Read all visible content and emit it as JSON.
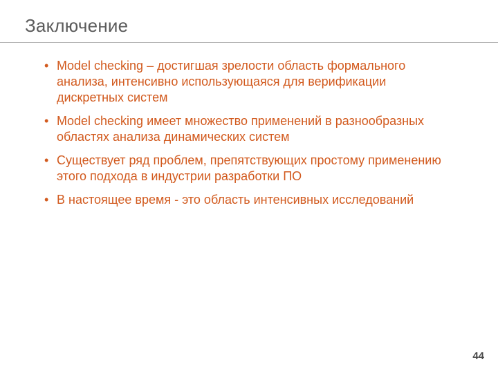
{
  "title": "Заключение",
  "bullets": [
    "Model checking – достигшая зрелости область формального анализа, интенсивно использующаяся для верификации дискретных систем",
    "Model checking имеет множество применений в разнообразных областях анализа динамических систем",
    "Существует ряд проблем, препятствующих простому применению этого подхода в индустрии разработки ПО",
    "В настоящее время - это область интенсивных исследований"
  ],
  "page_number": "44",
  "colors": {
    "accent": "#d25a1e",
    "title": "#5c5c5c",
    "rule": "#b5b5b5"
  }
}
